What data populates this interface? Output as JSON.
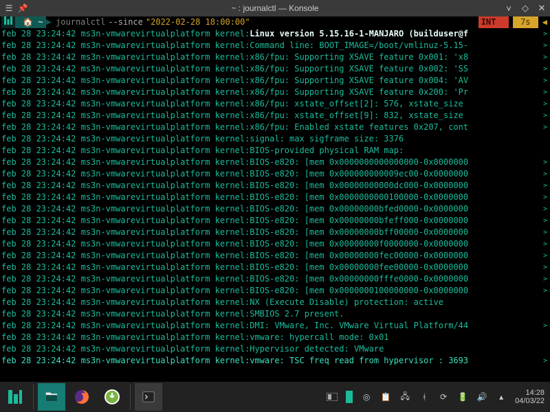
{
  "titlebar": {
    "title": "~ : journalctl — Konsole"
  },
  "prompt": {
    "manjaro": "",
    "home": "~",
    "cmd": "journalctl",
    "flag": "--since",
    "arg": "\"2022-02-28 18:00:00\"",
    "int_label": "INT",
    "int_x": "✘",
    "elapsed": "7s"
  },
  "log": {
    "prefix": "feb 28 23:24:42 ms3n-vmwarevirtualplatform kernel:",
    "lines": [
      {
        "msg": " Linux version 5.15.16-1-MANJARO (builduser@f",
        "bold": true,
        "caret": true
      },
      {
        "msg": " Command line: BOOT_IMAGE=/boot/vmlinuz-5.15-",
        "caret": true
      },
      {
        "msg": " x86/fpu: Supporting XSAVE feature 0x001: 'x8",
        "caret": true
      },
      {
        "msg": " x86/fpu: Supporting XSAVE feature 0x002: 'SS",
        "caret": true
      },
      {
        "msg": " x86/fpu: Supporting XSAVE feature 0x004: 'AV",
        "caret": true
      },
      {
        "msg": " x86/fpu: Supporting XSAVE feature 0x200: 'Pr",
        "caret": true
      },
      {
        "msg": " x86/fpu: xstate_offset[2]:  576, xstate_size",
        "caret": true
      },
      {
        "msg": " x86/fpu: xstate_offset[9]:  832, xstate_size",
        "caret": true
      },
      {
        "msg": " x86/fpu: Enabled xstate features 0x207, cont",
        "caret": true
      },
      {
        "msg": " signal: max sigframe size: 3376"
      },
      {
        "msg": " BIOS-provided physical RAM map:"
      },
      {
        "msg": " BIOS-e820: [mem 0x0000000000000000-0x0000000",
        "caret": true
      },
      {
        "msg": " BIOS-e820: [mem 0x000000000009ec00-0x0000000",
        "caret": true
      },
      {
        "msg": " BIOS-e820: [mem 0x00000000000dc000-0x0000000",
        "caret": true
      },
      {
        "msg": " BIOS-e820: [mem 0x0000000000100000-0x0000000",
        "caret": true
      },
      {
        "msg": " BIOS-e820: [mem 0x00000000bfed0000-0x0000000",
        "caret": true
      },
      {
        "msg": " BIOS-e820: [mem 0x00000000bfeff000-0x0000000",
        "caret": true
      },
      {
        "msg": " BIOS-e820: [mem 0x00000000bff00000-0x0000000",
        "caret": true
      },
      {
        "msg": " BIOS-e820: [mem 0x00000000f0000000-0x0000000",
        "caret": true
      },
      {
        "msg": " BIOS-e820: [mem 0x00000000fec00000-0x0000000",
        "caret": true
      },
      {
        "msg": " BIOS-e820: [mem 0x00000000fee00000-0x0000000",
        "caret": true
      },
      {
        "msg": " BIOS-e820: [mem 0x00000000fffe0000-0x0000000",
        "caret": true
      },
      {
        "msg": " BIOS-e820: [mem 0x0000000100000000-0x0000000",
        "caret": true
      },
      {
        "msg": " NX (Execute Disable) protection: active"
      },
      {
        "msg": " SMBIOS 2.7 present."
      },
      {
        "msg": " DMI: VMware, Inc. VMware Virtual Platform/44",
        "caret": true
      },
      {
        "msg": " vmware: hypercall mode: 0x01"
      },
      {
        "msg": " Hypervisor detected: VMware"
      },
      {
        "msg": " vmware: TSC freq read from hypervisor : 3693",
        "caret": true,
        "current": true
      }
    ]
  },
  "clock": {
    "time": "14:28",
    "date": "04/03/22"
  }
}
